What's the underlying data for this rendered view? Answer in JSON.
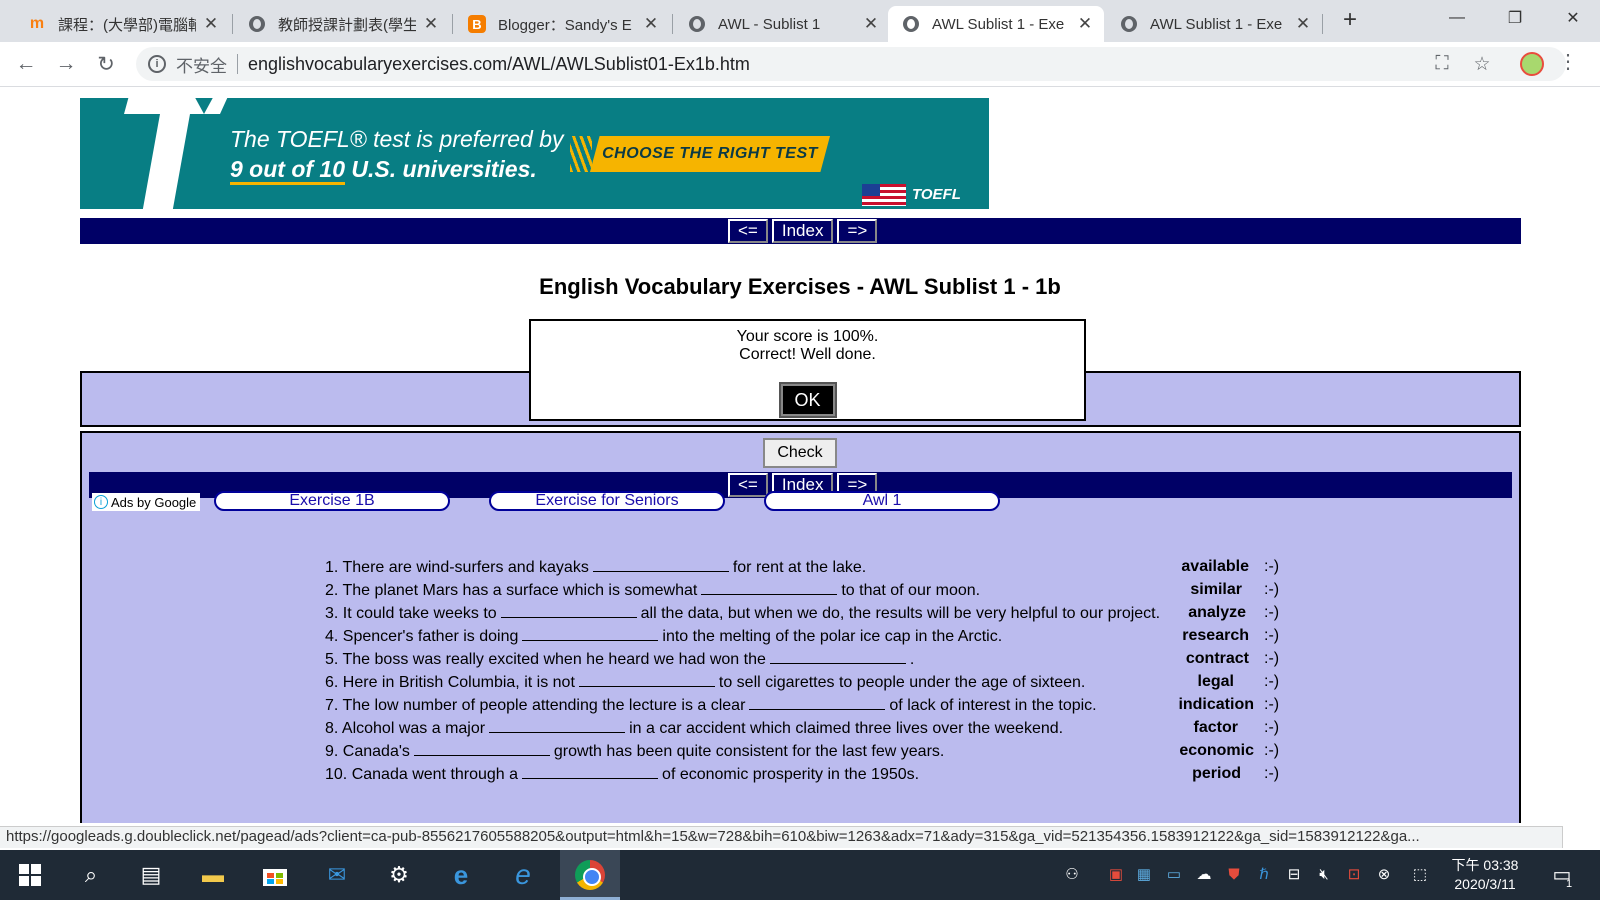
{
  "browser": {
    "tabs": [
      {
        "title": "課程：(大學部)電腦輔",
        "icon": "moodle-icon"
      },
      {
        "title": "教師授課計劃表(學生",
        "icon": "globe-icon"
      },
      {
        "title": "Blogger：Sandy's E",
        "icon": "blogger-icon"
      },
      {
        "title": "AWL - Sublist 1",
        "icon": "globe-icon"
      },
      {
        "title": "AWL Sublist 1 - Exe",
        "icon": "globe-icon",
        "active": true
      },
      {
        "title": "AWL Sublist 1 - Exe",
        "icon": "globe-icon"
      }
    ],
    "new_tab": "+",
    "security_label": "不安全",
    "url": "englishvocabularyexercises.com/AWL/AWLSublist01-Ex1b.htm",
    "status_url": "https://googleads.g.doubleclick.net/pagead/ads?client=ca-pub-8556217605588205&output=html&h=15&w=728&bih=610&biw=1263&adx=71&ady=315&ga_vid=521354356.1583912122&ga_sid=1583912122&ga..."
  },
  "ad": {
    "line1": "The TOEFL® test is preferred by",
    "line2_em": "9 out of 10",
    "line2_rest": " U.S. universities.",
    "cta": "CHOOSE THE RIGHT TEST",
    "brand": "TOEFL",
    "info_icon": "ⓘ",
    "close_icon": "✕"
  },
  "nav": {
    "prev": "<=",
    "index": "Index",
    "next": "=>"
  },
  "page": {
    "title": "English Vocabulary Exercises - AWL Sublist 1 - 1b"
  },
  "dialog": {
    "line1": "Your score is 100%.",
    "line2": "Correct! Well done.",
    "ok": "OK"
  },
  "check_label": "Check",
  "ads_by_google": "Ads by Google",
  "ad_links": [
    "Exercise 1B",
    "Exercise for Seniors",
    "Awl 1"
  ],
  "questions": [
    {
      "num": "1.",
      "before": "There are wind-surfers and kayaks",
      "after": "for rent at the lake.",
      "answer": "available",
      "mark": ":-)"
    },
    {
      "num": "2.",
      "before": "The planet Mars has a surface which is somewhat",
      "after": "to that of our moon.",
      "answer": "similar",
      "mark": ":-)"
    },
    {
      "num": "3.",
      "before": "It could take weeks to",
      "after": "all the data, but when we do, the results will be very helpful to our project.",
      "answer": "analyze",
      "mark": ":-)"
    },
    {
      "num": "4.",
      "before": "Spencer's father is doing",
      "after": "into the melting of the polar ice cap in the Arctic.",
      "answer": "research",
      "mark": ":-)"
    },
    {
      "num": "5.",
      "before": "The boss was really excited when he heard we had won the",
      "after": ".",
      "answer": "contract",
      "mark": ":-)"
    },
    {
      "num": "6.",
      "before": "Here in British Columbia, it is not",
      "after": "to sell cigarettes to people under the age of sixteen.",
      "answer": "legal",
      "mark": ":-)"
    },
    {
      "num": "7.",
      "before": "The low number of people attending the lecture is a clear",
      "after": "of lack of interest in the topic.",
      "answer": "indication",
      "mark": ":-)"
    },
    {
      "num": "8.",
      "before": "Alcohol was a major",
      "after": "in a car accident which claimed three lives over the weekend.",
      "answer": "factor",
      "mark": ":-)"
    },
    {
      "num": "9.",
      "before": "Canada's",
      "after": "growth has been quite consistent for the last few years.",
      "answer": "economic",
      "mark": ":-)"
    },
    {
      "num": "10.",
      "before": "Canada went through a",
      "after": "of economic prosperity in the 1950s.",
      "answer": "period",
      "mark": ":-)"
    }
  ],
  "taskbar": {
    "time": "下午 03:38",
    "date": "2020/3/11",
    "notification_count": "1"
  },
  "colors": {
    "nav_bg": "#000066",
    "panel_bg": "#bbbbee",
    "ad_bg": "#087e84",
    "ad_accent": "#f6b400"
  }
}
